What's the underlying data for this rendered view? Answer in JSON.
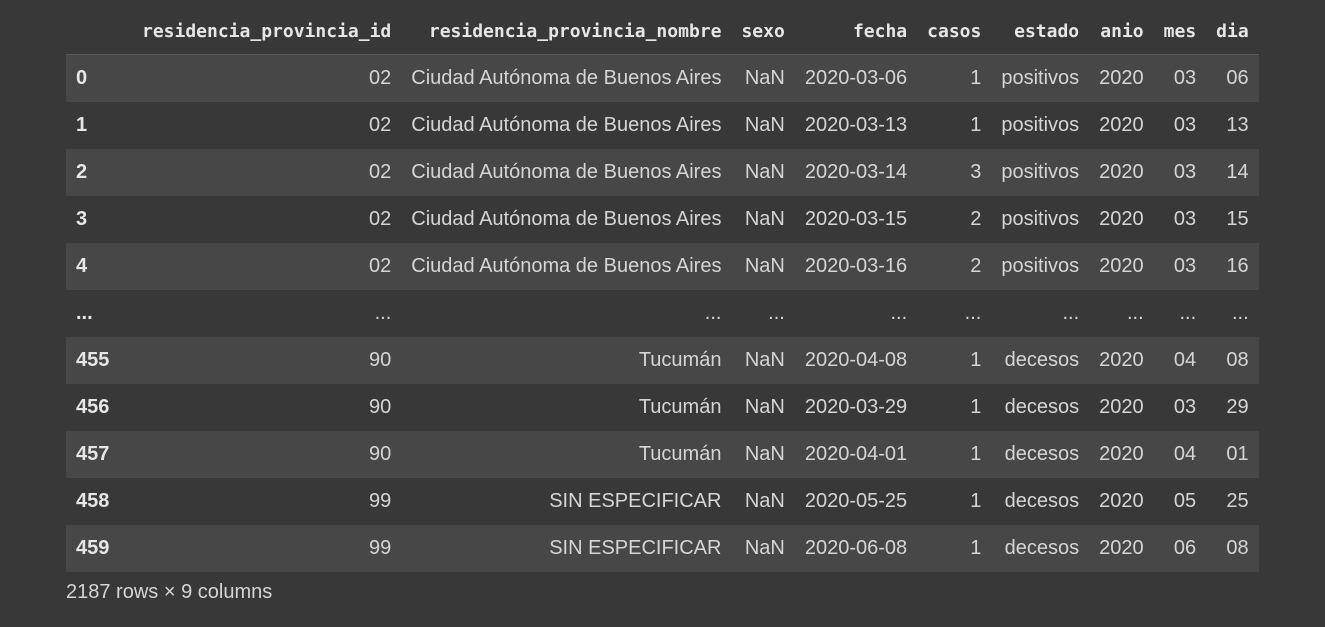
{
  "table": {
    "columns": [
      "residencia_provincia_id",
      "residencia_provincia_nombre",
      "sexo",
      "fecha",
      "casos",
      "estado",
      "anio",
      "mes",
      "dia"
    ],
    "rows": [
      {
        "index": "0",
        "cells": [
          "02",
          "Ciudad Autónoma de Buenos Aires",
          "NaN",
          "2020-03-06",
          "1",
          "positivos",
          "2020",
          "03",
          "06"
        ]
      },
      {
        "index": "1",
        "cells": [
          "02",
          "Ciudad Autónoma de Buenos Aires",
          "NaN",
          "2020-03-13",
          "1",
          "positivos",
          "2020",
          "03",
          "13"
        ]
      },
      {
        "index": "2",
        "cells": [
          "02",
          "Ciudad Autónoma de Buenos Aires",
          "NaN",
          "2020-03-14",
          "3",
          "positivos",
          "2020",
          "03",
          "14"
        ]
      },
      {
        "index": "3",
        "cells": [
          "02",
          "Ciudad Autónoma de Buenos Aires",
          "NaN",
          "2020-03-15",
          "2",
          "positivos",
          "2020",
          "03",
          "15"
        ]
      },
      {
        "index": "4",
        "cells": [
          "02",
          "Ciudad Autónoma de Buenos Aires",
          "NaN",
          "2020-03-16",
          "2",
          "positivos",
          "2020",
          "03",
          "16"
        ]
      },
      {
        "index": "...",
        "cells": [
          "...",
          "...",
          "...",
          "...",
          "...",
          "...",
          "...",
          "...",
          "..."
        ]
      },
      {
        "index": "455",
        "cells": [
          "90",
          "Tucumán",
          "NaN",
          "2020-04-08",
          "1",
          "decesos",
          "2020",
          "04",
          "08"
        ]
      },
      {
        "index": "456",
        "cells": [
          "90",
          "Tucumán",
          "NaN",
          "2020-03-29",
          "1",
          "decesos",
          "2020",
          "03",
          "29"
        ]
      },
      {
        "index": "457",
        "cells": [
          "90",
          "Tucumán",
          "NaN",
          "2020-04-01",
          "1",
          "decesos",
          "2020",
          "04",
          "01"
        ]
      },
      {
        "index": "458",
        "cells": [
          "99",
          "SIN ESPECIFICAR",
          "NaN",
          "2020-05-25",
          "1",
          "decesos",
          "2020",
          "05",
          "25"
        ]
      },
      {
        "index": "459",
        "cells": [
          "99",
          "SIN ESPECIFICAR",
          "NaN",
          "2020-06-08",
          "1",
          "decesos",
          "2020",
          "06",
          "08"
        ]
      }
    ],
    "dimensions": "2187 rows × 9 columns"
  },
  "colors": {
    "background": "#383838",
    "row_alt": "#474747",
    "text": "#d5d5d5"
  }
}
